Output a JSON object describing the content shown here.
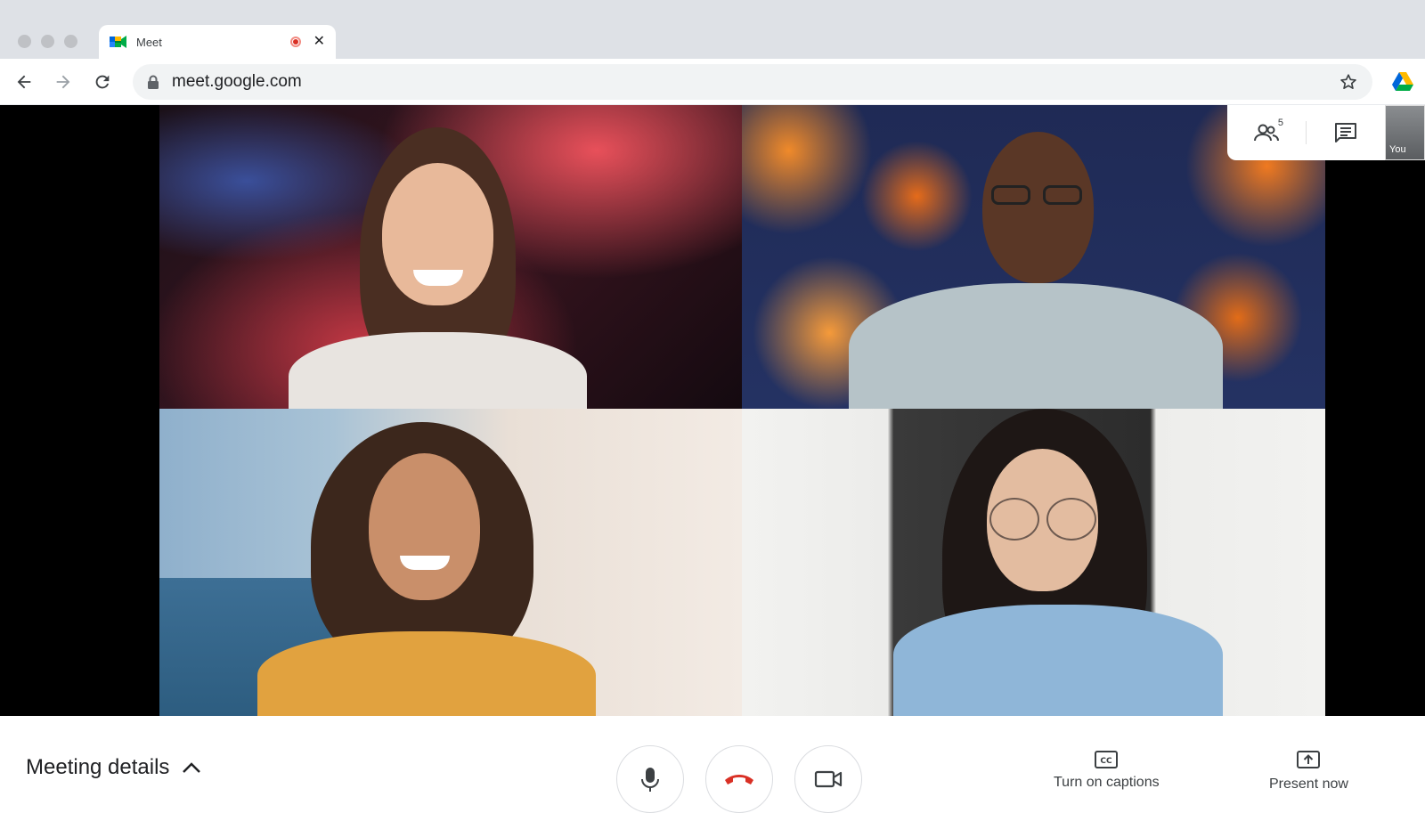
{
  "browser": {
    "tab_title": "Meet",
    "url": "meet.google.com"
  },
  "stage": {
    "participants_count": "5",
    "self_label": "You"
  },
  "controls": {
    "meeting_details_label": "Meeting details",
    "captions_label": "Turn on captions",
    "present_label": "Present now"
  },
  "colors": {
    "end_call_red": "#d93025",
    "recording_red": "#d93025",
    "chrome_bg": "#dee1e6"
  },
  "icons": [
    "back-icon",
    "forward-icon",
    "reload-icon",
    "lock-icon",
    "star-icon",
    "drive-icon",
    "people-icon",
    "chat-icon",
    "mic-icon",
    "end-call-icon",
    "camera-icon",
    "captions-icon",
    "present-icon",
    "chevron-up-icon"
  ]
}
